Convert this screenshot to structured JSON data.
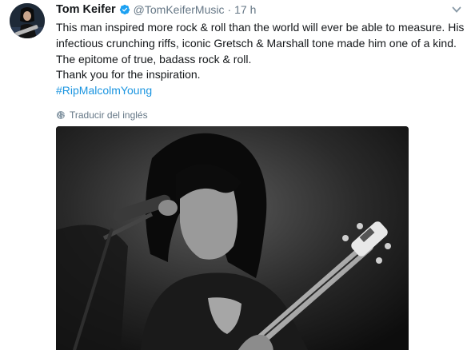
{
  "tweet": {
    "author_name": "Tom Keifer",
    "handle": "@TomKeiferMusic",
    "separator": "·",
    "time": "17 h",
    "lines": [
      "This man inspired more rock & roll than the world will ever be able to measure. His",
      "infectious crunching riffs, iconic Gretsch & Marshall tone made him one of a kind.",
      "The epitome of true, badass rock & roll.",
      "Thank you for the inspiration."
    ],
    "hashtag": "#RipMalcolmYoung",
    "translate_label": "Traducir del inglés"
  },
  "icons": {
    "verified": "verified-badge-icon",
    "caret": "chevron-down-icon",
    "globe": "globe-icon"
  },
  "colors": {
    "text": "#14171a",
    "secondary": "#657786",
    "link": "#1b95e0",
    "verified": "#1da1f2"
  }
}
